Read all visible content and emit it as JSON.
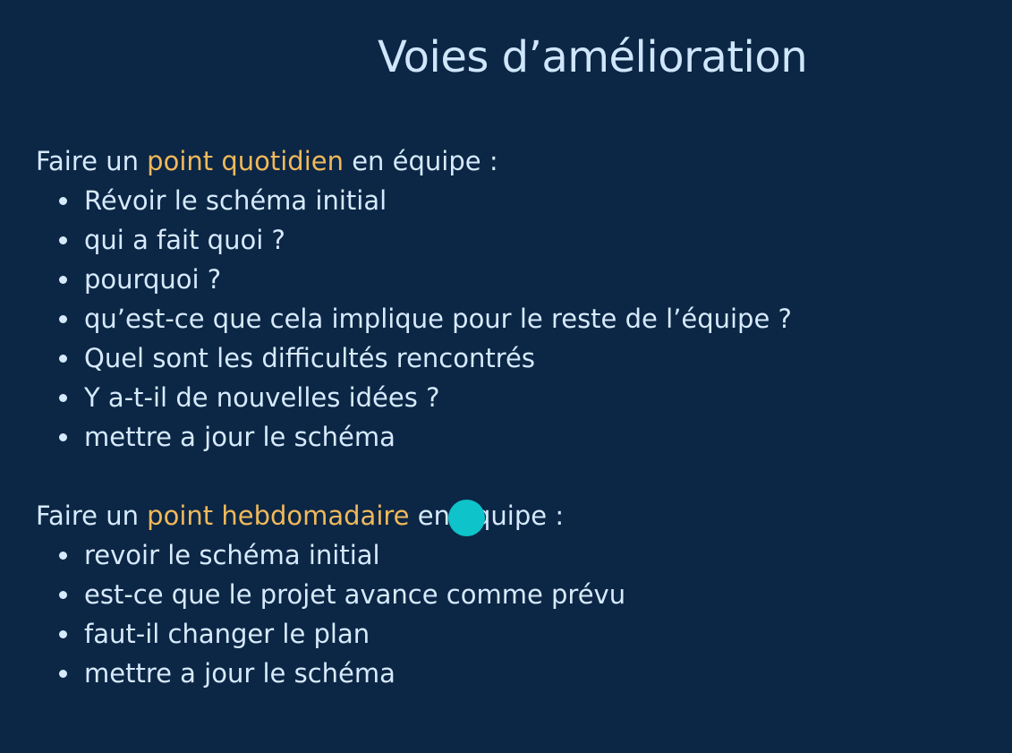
{
  "slide": {
    "title": "Voies d’amélioration",
    "sections": [
      {
        "heading_prefix": "Faire un ",
        "heading_highlight": "point quotidien",
        "heading_suffix": " en équipe :",
        "items": [
          "Révoir le schéma initial",
          "qui a fait quoi ?",
          "pourquoi ?",
          "qu’est-ce que cela implique pour le reste de l’équipe ?",
          "Quel sont les difficultés rencontrés",
          "Y a-t-il de nouvelles idées ?",
          "mettre a jour le schéma"
        ]
      },
      {
        "heading_prefix": "Faire un ",
        "heading_highlight": "point hebdomadaire",
        "heading_suffix": "  en équipe :",
        "items": [
          "revoir le schéma initial",
          "est-ce que le projet avance comme prévu",
          "faut-il changer le plan",
          "mettre a jour le schéma"
        ]
      }
    ]
  },
  "colors": {
    "background": "#0c2645",
    "text": "#d6eafc",
    "highlight": "#f0b95a",
    "pointer": "#0ec3c9"
  }
}
